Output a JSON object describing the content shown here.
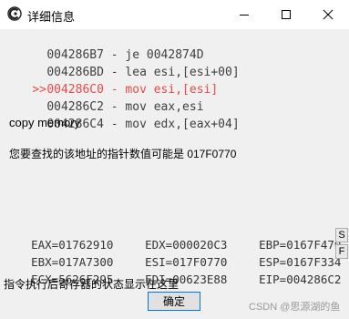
{
  "window": {
    "title": "详细信息",
    "icon": "app-icon",
    "controls": [
      "minimize-icon",
      "maximize-icon",
      "close-icon"
    ]
  },
  "code_lines": [
    {
      "marker": "",
      "address": "004286B7",
      "instruction": "je 0042874D",
      "current": false
    },
    {
      "marker": "",
      "address": "004286BD",
      "instruction": "lea esi,[esi+00]",
      "current": false
    },
    {
      "marker": ">>",
      "address": "004286C0",
      "instruction": "mov esi,[esi]",
      "current": true
    },
    {
      "marker": "",
      "address": "004286C2",
      "instruction": "mov eax,esi",
      "current": false
    },
    {
      "marker": "",
      "address": "004286C4",
      "instruction": "mov edx,[eax+04]",
      "current": false
    }
  ],
  "comment": "copy memory",
  "message": "您要查找的该地址的指针数值可能是 017F0770",
  "registers": {
    "row1": {
      "a": "EAX=01762910",
      "b": "EDX=000020C3",
      "c": "EBP=0167F470"
    },
    "row2": {
      "a": "EBX=017A7300",
      "b": "ESI=017F0770",
      "c": "ESP=0167F334"
    },
    "row3": {
      "a": "ECX=5626F295",
      "b": "EDI=00623E88",
      "c": "EIP=004286C2"
    }
  },
  "side_buttons": {
    "s": "S",
    "f": "F"
  },
  "status_text": "指令执行后寄存器的状态显示在这里",
  "ok_label": "确定",
  "watermark": "CSDN @思源湖的鱼",
  "colors": {
    "current_line": "#e84a4a",
    "button_border": "#0078d7"
  }
}
